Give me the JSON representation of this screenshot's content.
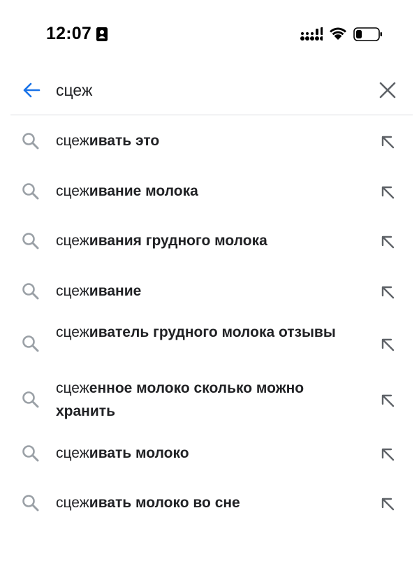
{
  "status_bar": {
    "time": "12:07"
  },
  "search": {
    "query": "сцеж"
  },
  "suggestions": [
    {
      "prefix": "сцеж",
      "rest": "ивать это"
    },
    {
      "prefix": "сцеж",
      "rest": "ивание молока"
    },
    {
      "prefix": "сцеж",
      "rest": "ивания грудного молока"
    },
    {
      "prefix": "сцеж",
      "rest": "ивание"
    },
    {
      "prefix": "сцеж",
      "rest": "иватель грудного молока отзывы"
    },
    {
      "prefix": "сцеж",
      "rest": "енное молоко сколько можно хранить"
    },
    {
      "prefix": "сцеж",
      "rest": "ивать молоко"
    },
    {
      "prefix": "сцеж",
      "rest": "ивать молоко во сне"
    }
  ],
  "colors": {
    "accent": "#1a73e8",
    "text": "#202124",
    "icon_gray": "#9aa0a6",
    "divider": "#dadce0"
  },
  "icons": {
    "back": "arrow-left-icon",
    "clear": "close-icon",
    "suggestion": "search-icon",
    "fill": "arrow-up-left-icon"
  }
}
